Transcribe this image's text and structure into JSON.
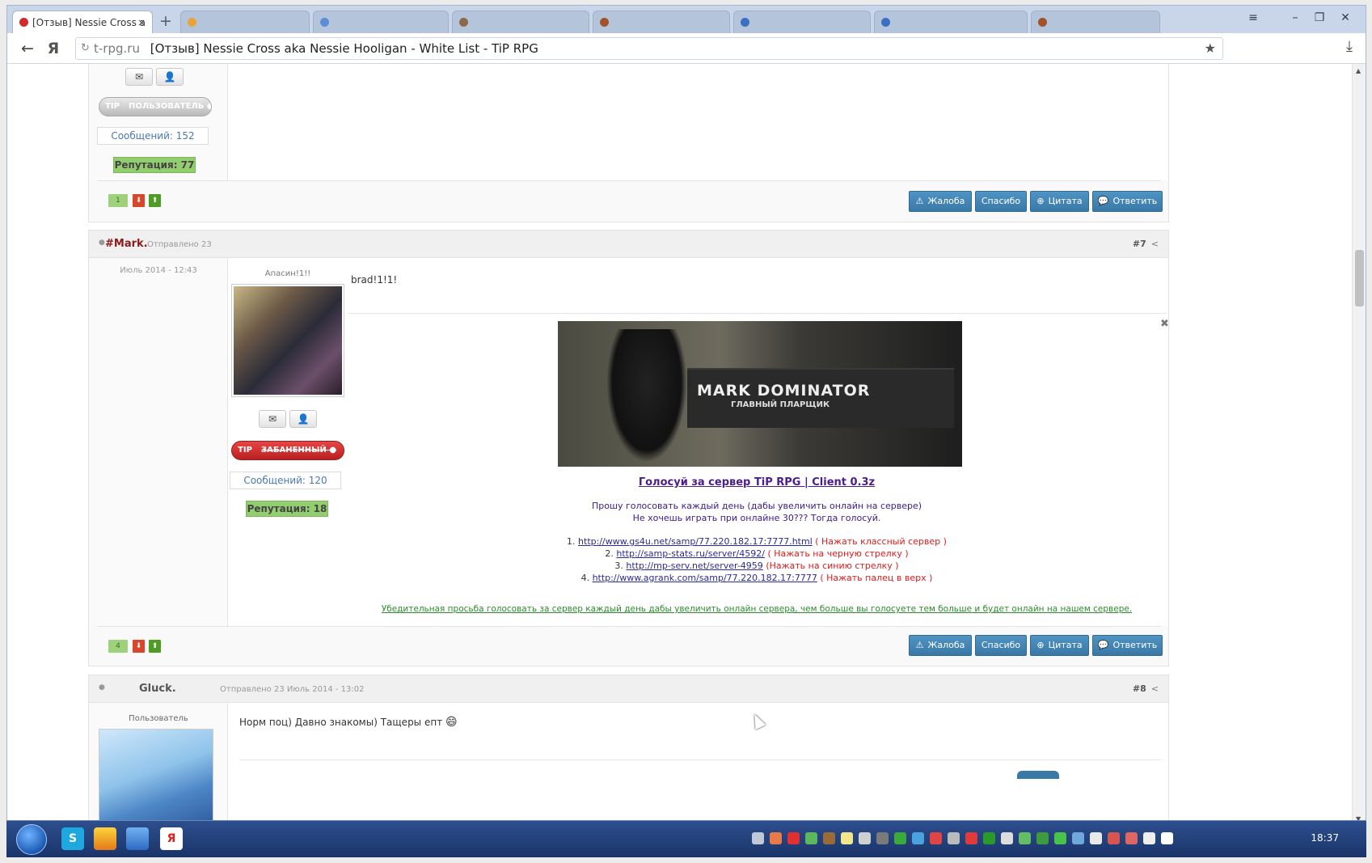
{
  "browser": {
    "active_tab": "[Отзыв] Nessie Cross a",
    "close_glyph": "×",
    "new_tab_glyph": "+",
    "url_host": "t-rpg.ru",
    "url_title": "[Отзыв] Nessie Cross aka Nessie Hooligan - White List - TiP RPG",
    "back_glyph": "←",
    "yandex_glyph": "Я",
    "reload_glyph": "↻",
    "star_glyph": "★",
    "download_glyph": "⤓",
    "menu_glyph": "≡",
    "minimize_glyph": "–",
    "restore_glyph": "❐",
    "window_close_glyph": "✕"
  },
  "colors": {
    "username_accent": "#8b1a1a",
    "button_blue": "#3a78a6",
    "reputation_green": "#92cd6f",
    "banned_red": "#c82727",
    "vote_green": "#4e9c25",
    "vote_red": "#d9472a"
  },
  "post6": {
    "rank_tip": "TIP",
    "rank_label": "ПОЛЬЗОВАТЕЛЬ ●",
    "messages": "Сообщений: 152",
    "reputation": "Репутация: 77",
    "votes": "1"
  },
  "actions": {
    "report": "Жалоба",
    "thanks": "Спасибо",
    "quote": "Цитата",
    "reply": "Ответить"
  },
  "icons": {
    "envelope_glyph": "✉",
    "profile_glyph": "👤",
    "vote_down_glyph": "⬇",
    "vote_up_glyph": "⬆",
    "report_glyph": "⚠",
    "quote_glyph": "⊕",
    "reply_glyph": "💬",
    "share_glyph": "<",
    "dismiss_glyph": "✖",
    "status_dot_glyph": "●",
    "emoji_glyph": "😄"
  },
  "post7": {
    "author": "#Mark.",
    "sent_label": "Отправлено 23",
    "date_line": "Июль 2014 - 12:43",
    "number": "#7",
    "user_title": "Апасин!1!!",
    "rank_tip": "TIP",
    "rank_label": "ЗАБАНЕННЫЙ ●",
    "messages": "Сообщений: 120",
    "reputation": "Репутация: 18",
    "votes": "4",
    "content": "brad!1!1!",
    "signature": {
      "banner_line1": "MARK DOMINATOR",
      "banner_line2": "ГЛАВНЫЙ ПЛАРЩИК",
      "vote_title": "Голосуй за сервер TiP RPG | Client 0.3z",
      "line1": "Прошу голосовать каждый день (дабы увеличить онлайн на сервере)",
      "line2": "Не хочешь играть при онлайне 30??? Тогда голосуй.",
      "links": [
        {
          "num": "1.",
          "url": "http://www.gs4u.net/samp/77.220.182.17:7777.html",
          "note": "( Нажать классный сервер )"
        },
        {
          "num": "2.",
          "url": "http://samp-stats.ru/server/4592/",
          "note": "( Нажать на черную стрелку )"
        },
        {
          "num": "3.",
          "url": "http://mp-serv.net/server-4959",
          "note": "(Нажать на синию стрелку )"
        },
        {
          "num": "4.",
          "url": "http://www.agrank.com/samp/77.220.182.17:7777",
          "note": "( Нажать палец в верх )"
        }
      ],
      "footer": "Убедительная просьба голосовать за сервер каждый день дабы увеличить онлайн сервера, чем больше вы голосуете тем больше и будет онлайн на нашем сервере."
    }
  },
  "post8": {
    "author": "Gluck.",
    "sent_label": "Отправлено 23 Июль 2014 - 13:02",
    "number": "#8",
    "user_title": "Пользователь",
    "content": "Норм поц) Давно знакомы) Тащеры епт"
  },
  "taskbar": {
    "clock": "18:37",
    "skype_glyph": "S",
    "yandex_glyph": "Я"
  }
}
